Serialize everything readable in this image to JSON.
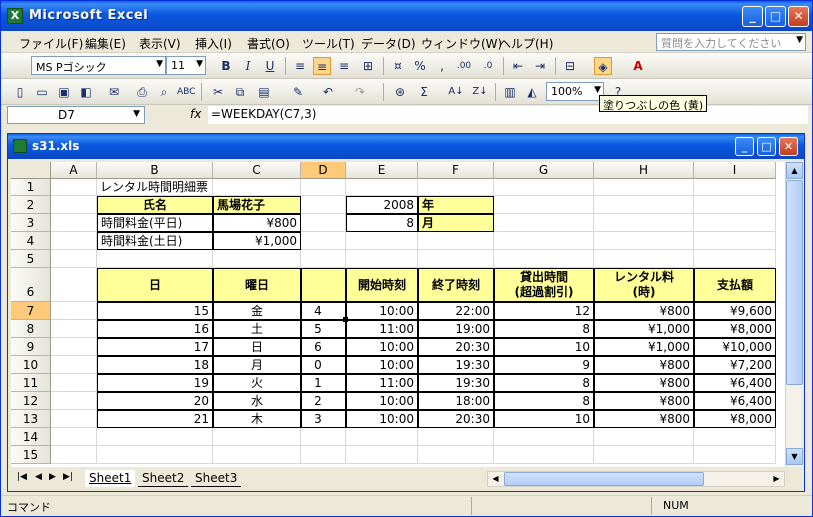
{
  "app": {
    "title": "Microsoft Excel",
    "icon": "excel-icon"
  },
  "menu": [
    "ファイル(F)",
    "編集(E)",
    "表示(V)",
    "挿入(I)",
    "書式(O)",
    "ツール(T)",
    "データ(D)",
    "ウィンドウ(W)",
    "ヘルプ(H)"
  ],
  "help_placeholder": "質問を入力してください",
  "toolbar": {
    "font_name": "MS Pゴシック",
    "font_size": "11",
    "zoom": "100%",
    "tooltip": "塗りつぶしの色 (黄)"
  },
  "formula_bar": {
    "cell_ref": "D7",
    "fx": "fx",
    "formula": "=WEEKDAY(C7,3)"
  },
  "workbook": {
    "title": "s31.xls"
  },
  "columns": [
    "A",
    "B",
    "C",
    "D",
    "E",
    "F",
    "G",
    "H",
    "I"
  ],
  "rows": [
    "1",
    "2",
    "3",
    "4",
    "5",
    "6",
    "7",
    "8",
    "9",
    "10",
    "11",
    "12",
    "13",
    "14",
    "15"
  ],
  "sheet": {
    "b1": "レンタル時間明細票",
    "b2": "氏名",
    "c2": "馬場花子",
    "e2": "2008",
    "f2": "年",
    "b3": "時間料金(平日)",
    "c3": "¥800",
    "e3": "8",
    "f3": "月",
    "b4": "時間料金(土日)",
    "c4": "¥1,000",
    "headers": {
      "b": "日",
      "c": "曜日",
      "d": "",
      "e": "開始時刻",
      "f": "終了時刻",
      "g1": "貸出時間",
      "g2": "(超過割引)",
      "h1": "レンタル料",
      "h2": "(時)",
      "i": "支払額"
    },
    "data": [
      {
        "day": "15",
        "wd": "金",
        "num": "4",
        "start": "10:00",
        "end": "22:00",
        "hours": "12",
        "rate": "¥800",
        "pay": "¥9,600"
      },
      {
        "day": "16",
        "wd": "土",
        "num": "5",
        "start": "11:00",
        "end": "19:00",
        "hours": "8",
        "rate": "¥1,000",
        "pay": "¥8,000"
      },
      {
        "day": "17",
        "wd": "日",
        "num": "6",
        "start": "10:00",
        "end": "20:30",
        "hours": "10",
        "rate": "¥1,000",
        "pay": "¥10,000"
      },
      {
        "day": "18",
        "wd": "月",
        "num": "0",
        "start": "10:00",
        "end": "19:30",
        "hours": "9",
        "rate": "¥800",
        "pay": "¥7,200"
      },
      {
        "day": "19",
        "wd": "火",
        "num": "1",
        "start": "11:00",
        "end": "19:30",
        "hours": "8",
        "rate": "¥800",
        "pay": "¥6,400"
      },
      {
        "day": "20",
        "wd": "水",
        "num": "2",
        "start": "10:00",
        "end": "18:00",
        "hours": "8",
        "rate": "¥800",
        "pay": "¥6,400"
      },
      {
        "day": "21",
        "wd": "木",
        "num": "3",
        "start": "10:00",
        "end": "20:30",
        "hours": "10",
        "rate": "¥800",
        "pay": "¥8,000"
      }
    ]
  },
  "tabs": [
    "Sheet1",
    "Sheet2",
    "Sheet3"
  ],
  "status": {
    "mode": "コマンド",
    "num": "NUM"
  },
  "colors": {
    "highlight": "#ffff99",
    "selected_header": "#ffc97a",
    "titlebar": "#0a5fe8"
  }
}
